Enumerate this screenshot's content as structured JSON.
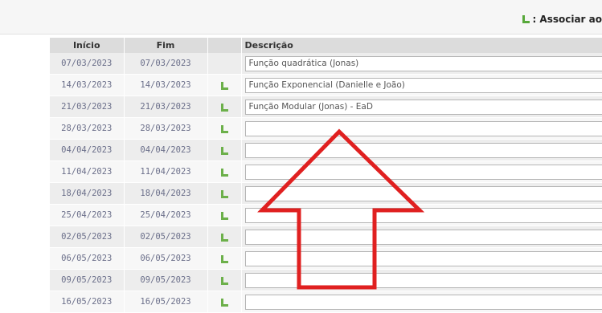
{
  "legend": {
    "text": ": Associar ao"
  },
  "columns": {
    "inicio": "Início",
    "fim": "Fim",
    "descricao": "Descrição"
  },
  "rows": [
    {
      "inicio": "07/03/2023",
      "fim": "07/03/2023",
      "icon": false,
      "descricao": "Função quadrática (Jonas)"
    },
    {
      "inicio": "14/03/2023",
      "fim": "14/03/2023",
      "icon": true,
      "descricao": "Função Exponencial (Danielle e João)"
    },
    {
      "inicio": "21/03/2023",
      "fim": "21/03/2023",
      "icon": true,
      "descricao": "Função Modular (Jonas) - EaD"
    },
    {
      "inicio": "28/03/2023",
      "fim": "28/03/2023",
      "icon": true,
      "descricao": ""
    },
    {
      "inicio": "04/04/2023",
      "fim": "04/04/2023",
      "icon": true,
      "descricao": ""
    },
    {
      "inicio": "11/04/2023",
      "fim": "11/04/2023",
      "icon": true,
      "descricao": ""
    },
    {
      "inicio": "18/04/2023",
      "fim": "18/04/2023",
      "icon": true,
      "descricao": ""
    },
    {
      "inicio": "25/04/2023",
      "fim": "25/04/2023",
      "icon": true,
      "descricao": ""
    },
    {
      "inicio": "02/05/2023",
      "fim": "02/05/2023",
      "icon": true,
      "descricao": ""
    },
    {
      "inicio": "06/05/2023",
      "fim": "06/05/2023",
      "icon": true,
      "descricao": ""
    },
    {
      "inicio": "09/05/2023",
      "fim": "09/05/2023",
      "icon": true,
      "descricao": ""
    },
    {
      "inicio": "16/05/2023",
      "fim": "16/05/2023",
      "icon": true,
      "descricao": ""
    }
  ],
  "icons": {
    "associate": "associate-corner-icon"
  },
  "colors": {
    "icon_green": "#6cb04a",
    "arrow_red": "#e02020",
    "header_bg": "#dcdcdc"
  }
}
